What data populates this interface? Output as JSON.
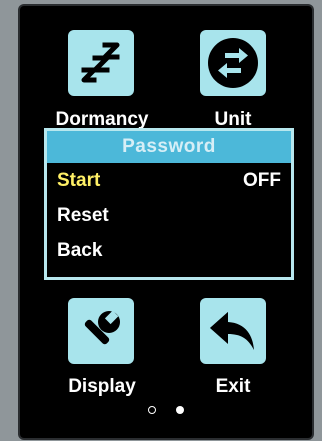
{
  "menu_icons": {
    "dormancy": {
      "label": "Dormancy",
      "icon": "sleep-zzz-icon"
    },
    "unit": {
      "label": "Unit",
      "icon": "swap-arrows-icon"
    },
    "display": {
      "label": "Display",
      "icon": "wrench-icon"
    },
    "exit": {
      "label": "Exit",
      "icon": "back-arrow-icon"
    }
  },
  "password_dialog": {
    "title": "Password",
    "items": [
      {
        "label": "Start",
        "value": "OFF",
        "selected": true
      },
      {
        "label": "Reset",
        "value": ""
      },
      {
        "label": "Back",
        "value": ""
      }
    ]
  },
  "pagination": {
    "total": 2,
    "current": 2
  },
  "colors": {
    "tile": "#a8e4ec",
    "dialog_title_bg": "#4cb8d9",
    "selected_text": "#fff066",
    "background": "#000000"
  }
}
